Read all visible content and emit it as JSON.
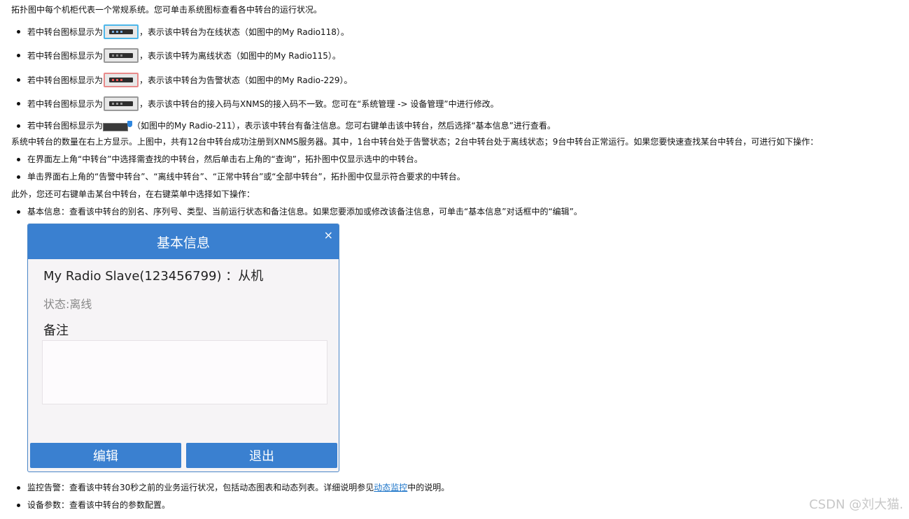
{
  "intro": "拓扑图中每个机柜代表一个常规系统。您可单击系统图标查看各中转台的运行状况。",
  "icon_states": [
    {
      "prefix": "若中转台图标显示为",
      "icon": "device-online-icon",
      "text": "，表示该中转台为在线状态（如图中的My Radio118）。"
    },
    {
      "prefix": "若中转台图标显示为",
      "icon": "device-offline-icon",
      "text": "，表示该中转为离线状态（如图中的My Radio115）。"
    },
    {
      "prefix": "若中转台图标显示为",
      "icon": "device-alarm-icon",
      "text": "，表示该中转台为告警状态（如图中的My Radio-229）。"
    },
    {
      "prefix": "若中转台图标显示为",
      "icon": "device-mismatch-icon",
      "text": "，表示该中转台的接入码与XNMS的接入码不一致。您可在“系统管理 -> 设备管理”中进行修改。"
    },
    {
      "prefix": "若中转台图标显示为",
      "icon": "device-note-icon",
      "text": "（如图中的My Radio-211），表示该中转台有备注信息。您可右键单击该中转台，然后选择“基本信息”进行查看。"
    }
  ],
  "count_text": "系统中转台的数量在右上方显示。上图中，共有12台中转台成功注册到XNMS服务器。其中，1台中转台处于告警状态；2台中转台处于离线状态；9台中转台正常运行。如果您要快速查找某台中转台，可进行如下操作：",
  "search_steps": [
    "在界面左上角“中转台”中选择需查找的中转台，然后单击右上角的“查询”，拓扑图中仅显示选中的中转台。",
    "单击界面右上角的“告警中转台”、“离线中转台”、“正常中转台”或“全部中转台”，拓扑图中仅显示符合要求的中转台。"
  ],
  "menu_intro": "此外，您还可右键单击某台中转台，在右键菜单中选择如下操作：",
  "menu_item_basic": "基本信息：查看该中转台的别名、序列号、类型、当前运行状态和备注信息。如果您要添加或修改该备注信息，可单击“基本信息”对话框中的“编辑”。",
  "dialog": {
    "title": "基本信息",
    "close": "×",
    "device_line": "My Radio Slave(123456799) ：从机",
    "status": "状态:离线",
    "note_label": "备注",
    "note_value": "",
    "edit_label": "编辑",
    "exit_label": "退出"
  },
  "menu_item_monitor": {
    "prefix": "监控告警：查看该中转台30秒之前的业务运行状况，包括动态图表和动态列表。详细说明参见",
    "link": "动态监控",
    "suffix": "中的说明。"
  },
  "menu_item_params": "设备参数：查看该中转台的参数配置。",
  "watermark": "CSDN @刘大猫.",
  "colors": {
    "dialog_header": "#3a80d0",
    "link": "#1a73c8",
    "online_border": "#4db7ea",
    "alarm_border": "#e88a8a"
  }
}
